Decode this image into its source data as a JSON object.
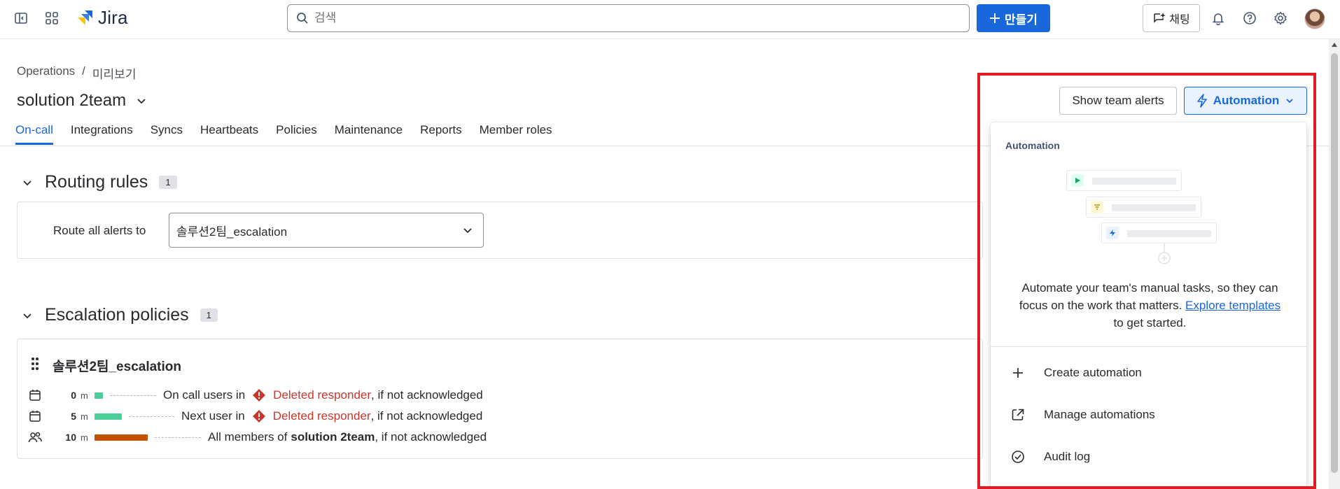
{
  "topnav": {
    "logo_text": "Jira",
    "search_placeholder": "검색",
    "create_label": "만들기",
    "chat_label": "채팅"
  },
  "breadcrumb": {
    "parent": "Operations",
    "separator": "/",
    "current": "미리보기"
  },
  "page": {
    "title": "solution 2team"
  },
  "tabs": [
    {
      "label": "On-call",
      "active": true
    },
    {
      "label": "Integrations"
    },
    {
      "label": "Syncs"
    },
    {
      "label": "Heartbeats"
    },
    {
      "label": "Policies"
    },
    {
      "label": "Maintenance"
    },
    {
      "label": "Reports"
    },
    {
      "label": "Member roles"
    }
  ],
  "actions": {
    "show_alerts_label": "Show team alerts",
    "automation_label": "Automation"
  },
  "routing": {
    "title": "Routing rules",
    "count": "1",
    "route_label": "Route all alerts to",
    "route_value": "솔루션2팀_escalation"
  },
  "escalation": {
    "title": "Escalation policies",
    "count": "1",
    "policy_name": "솔루션2팀_escalation",
    "rules": [
      {
        "icon": "calendar-icon",
        "minutes": "0",
        "unit": "m",
        "bar_color": "#4bce97",
        "bar_fraction": 0.1,
        "prefix": "On call users in",
        "target": "Deleted responder",
        "suffix": ", if not acknowledged"
      },
      {
        "icon": "calendar-icon",
        "minutes": "5",
        "unit": "m",
        "bar_color": "#4bce97",
        "bar_fraction": 0.5,
        "prefix": "Next user in",
        "target": "Deleted responder",
        "suffix": ", if not acknowledged"
      },
      {
        "icon": "people-icon",
        "minutes": "10",
        "unit": "m",
        "bar_color": "#c25100",
        "bar_fraction": 1.0,
        "prefix": "All members of",
        "target": "solution 2team",
        "suffix": ", if not acknowledged"
      }
    ]
  },
  "dropdown": {
    "header": "Automation",
    "description": "Automate your team's manual tasks, so they can focus on the work that matters.",
    "link_text": "Explore templates",
    "description_tail": "to get started.",
    "items": [
      {
        "label": "Create automation",
        "icon": "plus-icon"
      },
      {
        "label": "Manage automations",
        "icon": "external-link-icon"
      },
      {
        "label": "Audit log",
        "icon": "check-circle-icon"
      }
    ]
  },
  "colors": {
    "brand": "#1868db",
    "highlight": "#e21b22",
    "danger": "#c9372c"
  }
}
